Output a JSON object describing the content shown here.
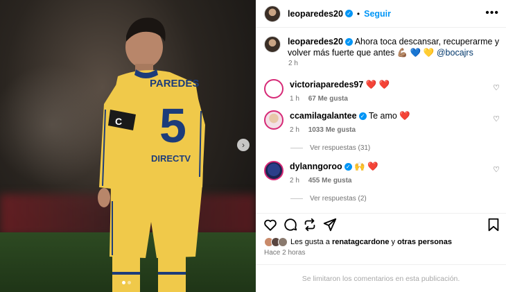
{
  "post": {
    "author": "leoparedes20",
    "follow_label": "Seguir",
    "caption_text": "Ahora toca descansar, recuperarme y volver más fuerte que antes",
    "caption_emojis": "💪🏽 💙 💛",
    "caption_mention": "@bocajrs",
    "caption_time": "2 h",
    "jersey_name": "PAREDES",
    "jersey_number": "5",
    "jersey_sponsor": "DIRECTV"
  },
  "comments": [
    {
      "user": "victoriaparedes97",
      "verified": false,
      "text": "",
      "emojis": "❤️ ❤️",
      "time": "1 h",
      "likes": "67 Me gusta"
    },
    {
      "user": "ccamilagalantee",
      "verified": true,
      "text": "Te amo",
      "emojis": "❤️",
      "time": "2 h",
      "likes": "1033 Me gusta",
      "replies": "Ver respuestas (31)"
    },
    {
      "user": "dylanngoroo",
      "verified": true,
      "text": "",
      "emojis": "🙌 ❤️",
      "time": "2 h",
      "likes": "455 Me gusta",
      "replies": "Ver respuestas (2)"
    }
  ],
  "liked_by": {
    "prefix": "Les gusta a",
    "user": "renatagcardone",
    "joiner": "y",
    "others": "otras personas"
  },
  "posted_ago": "Hace 2 horas",
  "footer_notice": "Se limitaron los comentarios en esta publicación.",
  "icons": {
    "like": "heart-icon",
    "comment": "comment-icon",
    "share": "share-icon",
    "save": "bookmark-icon",
    "more": "more-options-icon",
    "next": "chevron-right-icon"
  },
  "colors": {
    "accent": "#0095f6",
    "jersey": "#f0c94a",
    "jersey_stripe": "#1c3c7a",
    "heart": "#ed4956"
  }
}
